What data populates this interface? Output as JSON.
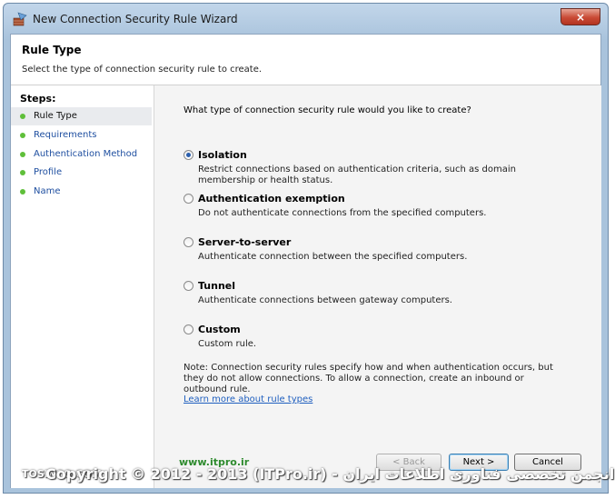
{
  "window": {
    "title": "New Connection Security Rule Wizard",
    "close_glyph": "×"
  },
  "header": {
    "title": "Rule Type",
    "description": "Select the type of connection security rule to create."
  },
  "steps": {
    "title": "Steps:",
    "items": [
      {
        "label": "Rule Type"
      },
      {
        "label": "Requirements"
      },
      {
        "label": "Authentication Method"
      },
      {
        "label": "Profile"
      },
      {
        "label": "Name"
      }
    ]
  },
  "content": {
    "question": "What type of connection security rule would you like to create?",
    "options": [
      {
        "label": "Isolation",
        "description": "Restrict connections based on authentication criteria, such as domain membership or health status.",
        "checked": true
      },
      {
        "label": "Authentication exemption",
        "description": "Do not authenticate connections from the specified computers.",
        "checked": false
      },
      {
        "label": "Server-to-server",
        "description": "Authenticate connection between the specified computers.",
        "checked": false
      },
      {
        "label": "Tunnel",
        "description": "Authenticate connections between gateway computers.",
        "checked": false
      },
      {
        "label": "Custom",
        "description": "Custom rule.",
        "checked": false
      }
    ],
    "note": "Note:  Connection security rules specify how and when authentication occurs, but they do not allow connections.  To allow a connection, create an inbound or outbound rule.",
    "learn_more": "Learn more about rule types"
  },
  "buttons": {
    "back": "< Back",
    "next": "Next >",
    "cancel": "Cancel"
  },
  "watermark": {
    "site": "www.itpro.ir",
    "left_text": "TOSINSO.COM",
    "copyright": "Copyright © 2012 - 2013 (ITPro.ir) - انجمن تخصصی فناوری اطلاعات ایران"
  },
  "colors": {
    "accent": "#1f4fa0",
    "step_dot": "#5fbf3a",
    "close": "#c94a35"
  }
}
